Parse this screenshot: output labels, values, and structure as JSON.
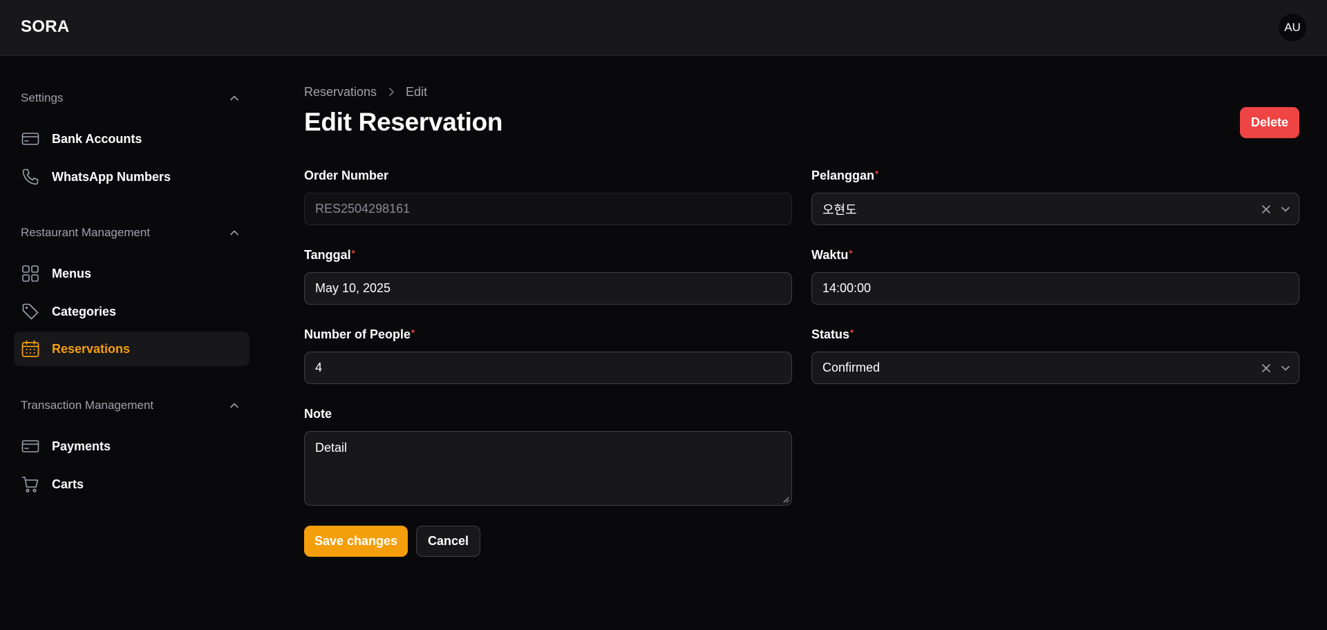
{
  "app": {
    "brand": "SORA",
    "user_initials": "AU"
  },
  "sidebar": {
    "groups": [
      {
        "label": "Settings",
        "items": [
          {
            "label": "Bank Accounts",
            "icon": "credit-card-icon"
          },
          {
            "label": "WhatsApp Numbers",
            "icon": "phone-icon"
          }
        ]
      },
      {
        "label": "Restaurant Management",
        "items": [
          {
            "label": "Menus",
            "icon": "grid-icon"
          },
          {
            "label": "Categories",
            "icon": "tag-icon"
          },
          {
            "label": "Reservations",
            "icon": "calendar-icon",
            "active": true
          }
        ]
      },
      {
        "label": "Transaction Management",
        "items": [
          {
            "label": "Payments",
            "icon": "credit-card-icon"
          },
          {
            "label": "Carts",
            "icon": "cart-icon"
          }
        ]
      }
    ]
  },
  "breadcrumb": {
    "parent": "Reservations",
    "current": "Edit"
  },
  "page": {
    "title": "Edit Reservation",
    "delete_label": "Delete"
  },
  "form": {
    "order_number": {
      "label": "Order Number",
      "value": "RES2504298161",
      "required": false,
      "disabled": true
    },
    "pelanggan": {
      "label": "Pelanggan",
      "value": "오현도",
      "required": true
    },
    "tanggal": {
      "label": "Tanggal",
      "value": "May 10, 2025",
      "required": true
    },
    "waktu": {
      "label": "Waktu",
      "value": "14:00:00",
      "required": true
    },
    "people": {
      "label": "Number of People",
      "value": "4",
      "required": true
    },
    "status": {
      "label": "Status",
      "value": "Confirmed",
      "required": true
    },
    "note": {
      "label": "Note",
      "value": "Detail",
      "required": false
    },
    "required_marker": "*"
  },
  "actions": {
    "save_label": "Save changes",
    "cancel_label": "Cancel"
  },
  "colors": {
    "accent": "#f59e0b",
    "danger": "#ef4444",
    "background": "#09090b",
    "surface": "#18181b"
  }
}
